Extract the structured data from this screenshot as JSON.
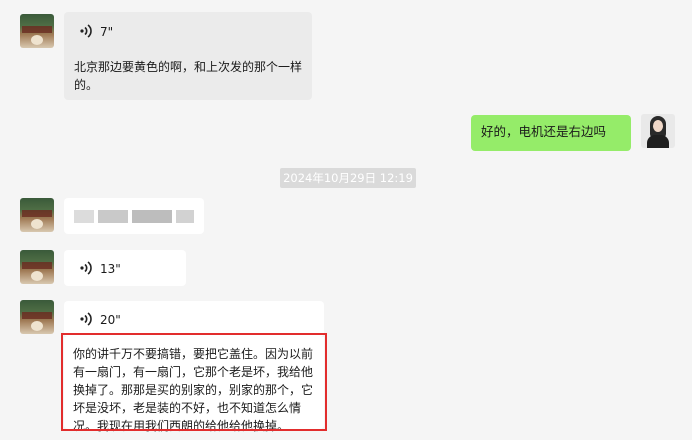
{
  "messages": {
    "m1_voice_length": "7\"",
    "m1_text": "北京那边要黄色的啊，和上次发的那个一样的。",
    "m2_text": "好的，电机还是右边吗",
    "timestamp": "2024年10月29日 12:19",
    "m4_voice_length": "13\"",
    "m5_voice_length": "20\"",
    "m5_transcript": "你的讲千万不要搞错，要把它盖住。因为以前有一扇门，有一扇门，它那个老是坏，我给他换掉了。那那是买的别家的，别家的那个，它坏是没坏，老是装的不好，也不知道怎么情况。我现在用我们西朗的给他给他换掉。"
  },
  "colors": {
    "incoming_bubble": "#ebebeb",
    "outgoing_bubble": "#95ec69",
    "highlight_border": "#e22d2d"
  },
  "icons": {
    "voice": "voice-wave-icon"
  }
}
